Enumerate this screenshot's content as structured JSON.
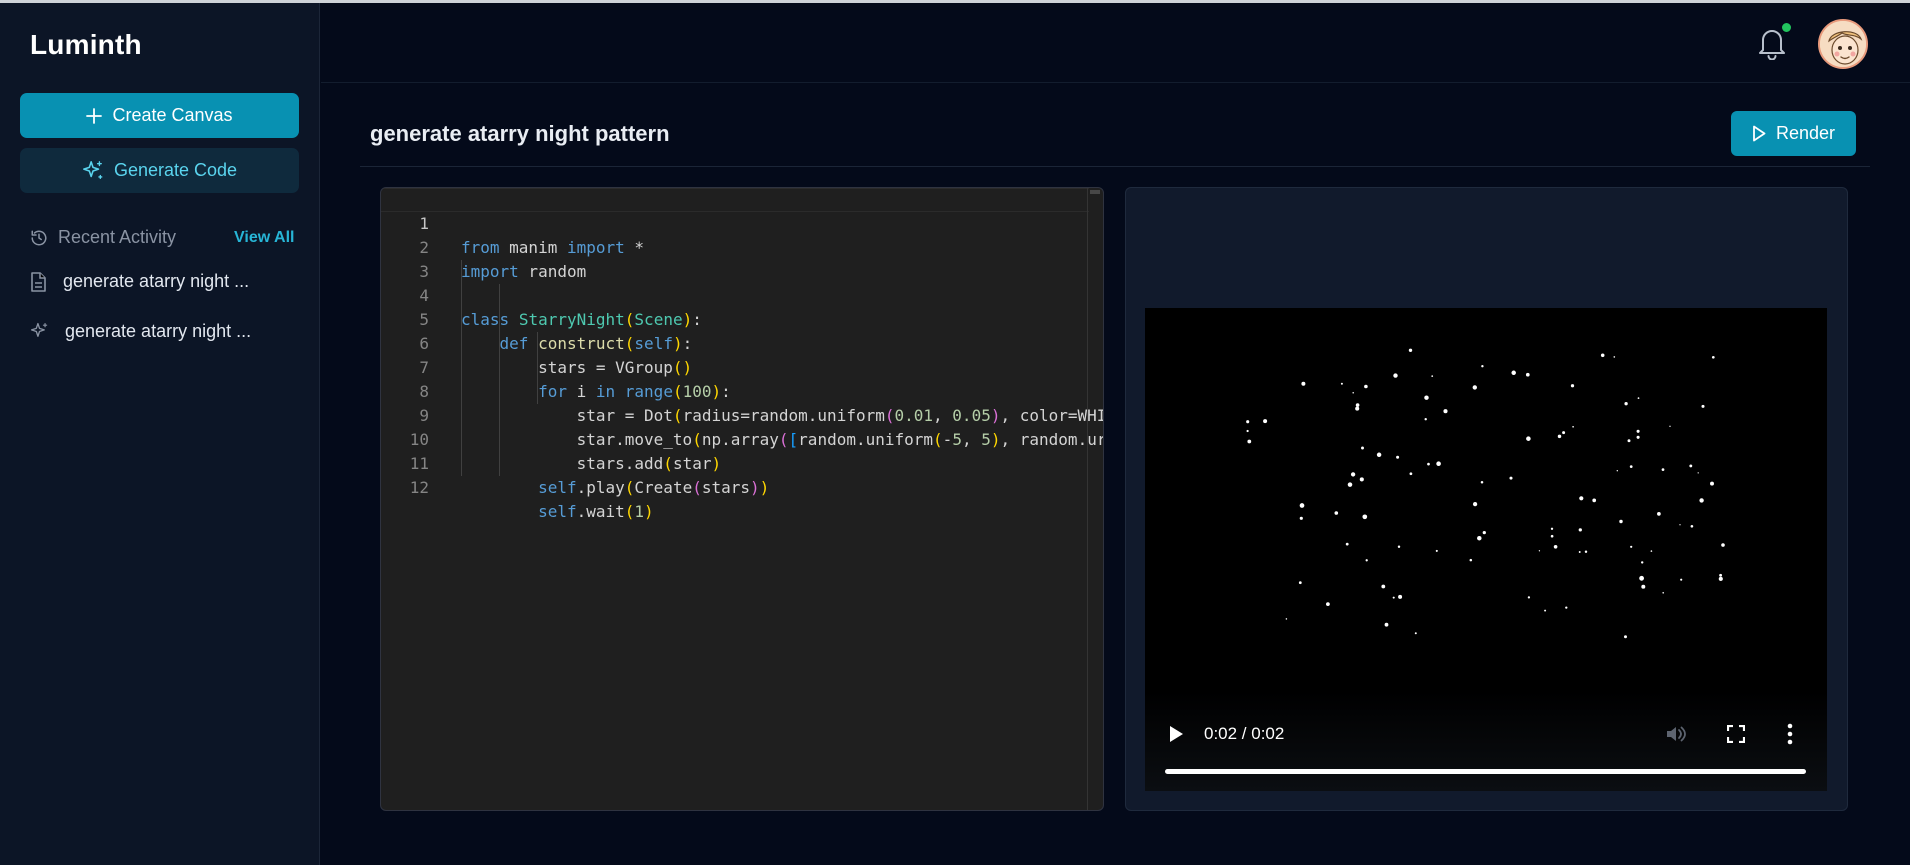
{
  "sidebar": {
    "brand": "Luminth",
    "create_label": "Create Canvas",
    "generate_label": "Generate Code",
    "recent_label": "Recent Activity",
    "view_all_label": "View All",
    "recent_items": [
      {
        "label": "generate atarry night ...",
        "icon": "document-icon"
      },
      {
        "label": "generate atarry night ...",
        "icon": "sparkle-icon"
      }
    ]
  },
  "header": {
    "notification_status_color": "#22c55e"
  },
  "main": {
    "title": "generate atarry night pattern",
    "render_label": "Render"
  },
  "editor": {
    "language": "python",
    "active_line": 1,
    "lines": [
      "from manim import *",
      "import random",
      "",
      "class StarryNight(Scene):",
      "    def construct(self):",
      "        stars = VGroup()",
      "        for i in range(100):",
      "            star = Dot(radius=random.uniform(0.01, 0.05), color=WHI",
      "            star.move_to(np.array([random.uniform(-5, 5), random.ur",
      "            stars.add(star)",
      "        self.play(Create(stars))",
      "        self.wait(1)"
    ]
  },
  "video": {
    "time": "0:02 / 0:02",
    "progress": 1.0
  },
  "colors": {
    "accent": "#0891b2",
    "accent_text": "#5ad4ee",
    "background": "#040a1a",
    "sidebar": "#0c1526"
  }
}
